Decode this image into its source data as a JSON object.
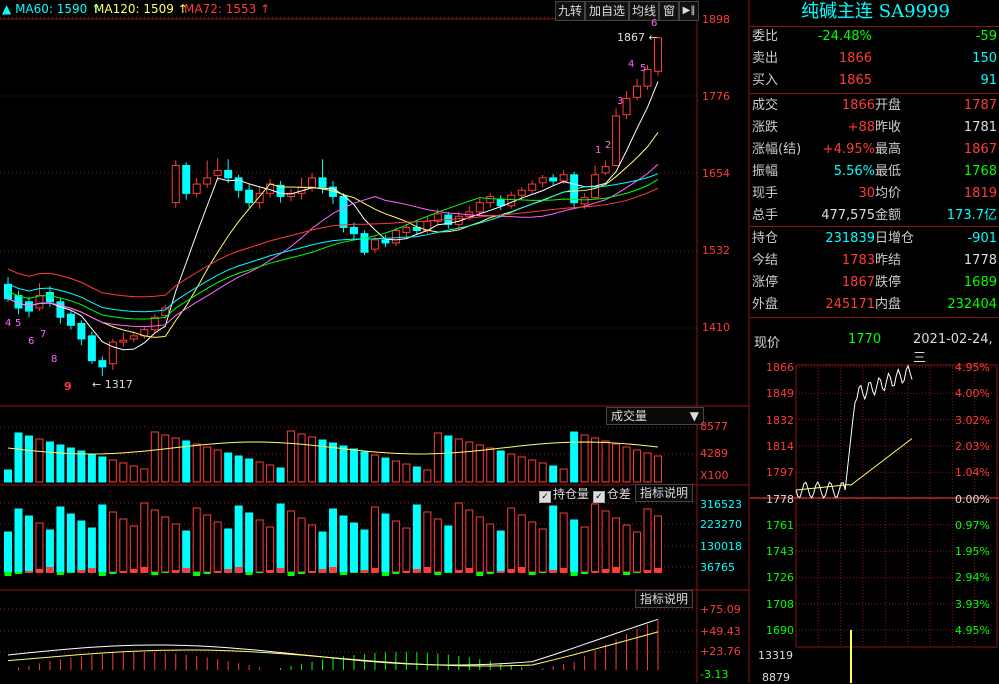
{
  "ma_legend": [
    {
      "label": "MA60: 1590",
      "color": "#00ffff"
    },
    {
      "label": "MA120: 1509",
      "color": "#ffff66"
    },
    {
      "label": "MA72: 1553",
      "color": "#ff3a3a"
    }
  ],
  "toolbar": {
    "jiuzhuan": "九转",
    "jiazixuan": "加自选",
    "junxian": "均线",
    "chuang": "窗",
    "side_icon": "▶‖"
  },
  "main_axis": [
    "1898",
    "1776",
    "1654",
    "1532",
    "1410"
  ],
  "annot": {
    "high": "1867",
    "low": "1317"
  },
  "nine_turn_up": [
    "1",
    "2",
    "3",
    "4",
    "5",
    "6"
  ],
  "nine_turn_down": [
    "4",
    "5",
    "6",
    "7",
    "8",
    "9"
  ],
  "volume": {
    "selector": "成交量",
    "axis": [
      "8577",
      "4289",
      "X100"
    ]
  },
  "oi": {
    "chk1": "持仓量",
    "chk2": "仓差",
    "btn": "指标说明",
    "axis": [
      "316523",
      "223270",
      "130018",
      "36765"
    ]
  },
  "ind": {
    "btn": "指标说明",
    "axis": [
      "+75.09",
      "+49.43",
      "+23.76",
      "-3.13"
    ]
  },
  "quote": {
    "title": "纯碱主连 SA9999",
    "rows": [
      {
        "l1": "委比",
        "v1": "-24.48%",
        "c1": "green",
        "v2": "-59",
        "c2": "green"
      },
      {
        "l1": "卖出",
        "v1": "1866",
        "c1": "red",
        "v2": "150",
        "c2": "cyan"
      },
      {
        "l1": "买入",
        "v1": "1865",
        "c1": "red",
        "v2": "91",
        "c2": "cyan"
      },
      {
        "l1": "成交",
        "v1": "1866",
        "c1": "red",
        "l2": "开盘",
        "v2": "1787",
        "c2": "red"
      },
      {
        "l1": "涨跌",
        "v1": "+88",
        "c1": "red",
        "l2": "昨收",
        "v2": "1781",
        "c2": "white"
      },
      {
        "l1": "涨幅(结)",
        "v1": "+4.95%",
        "c1": "red",
        "l2": "最高",
        "v2": "1867",
        "c2": "red"
      },
      {
        "l1": "振幅",
        "v1": "5.56%",
        "c1": "cyan",
        "l2": "最低",
        "v2": "1768",
        "c2": "green"
      },
      {
        "l1": "现手",
        "v1": "30",
        "c1": "red",
        "l2": "均价",
        "v2": "1819",
        "c2": "red"
      },
      {
        "l1": "总手",
        "v1": "477,575",
        "c1": "white",
        "l2": "金额",
        "v2": "173.7亿",
        "c2": "cyan"
      },
      {
        "l1": "持仓",
        "v1": "231839",
        "c1": "cyan",
        "l2": "日增仓",
        "v2": "-901",
        "c2": "cyan"
      },
      {
        "l1": "今结",
        "v1": "1783",
        "c1": "red",
        "l2": "昨结",
        "v2": "1778",
        "c2": "white"
      },
      {
        "l1": "涨停",
        "v1": "1867",
        "c1": "red",
        "l2": "跌停",
        "v2": "1689",
        "c2": "green"
      },
      {
        "l1": "外盘",
        "v1": "245171",
        "c1": "red",
        "l2": "内盘",
        "v2": "232404",
        "c2": "green"
      }
    ],
    "now_label": "现价",
    "now_value": "1770",
    "date": "2021-02-24,三"
  },
  "mini": {
    "left_axis": [
      {
        "v": "1866",
        "c": "#ff3a3a"
      },
      {
        "v": "1849",
        "c": "#ff3a3a"
      },
      {
        "v": "1832",
        "c": "#ff3a3a"
      },
      {
        "v": "1814",
        "c": "#ff3a3a"
      },
      {
        "v": "1797",
        "c": "#ff3a3a"
      },
      {
        "v": "1778",
        "c": "#ddd"
      },
      {
        "v": "1761",
        "c": "#00ff00"
      },
      {
        "v": "1743",
        "c": "#00ff00"
      },
      {
        "v": "1726",
        "c": "#00ff00"
      },
      {
        "v": "1708",
        "c": "#00ff00"
      },
      {
        "v": "1690",
        "c": "#00ff00"
      }
    ],
    "right_axis": [
      {
        "v": "4.95%",
        "c": "#ff3a3a"
      },
      {
        "v": "4.00%",
        "c": "#ff3a3a"
      },
      {
        "v": "3.02%",
        "c": "#ff3a3a"
      },
      {
        "v": "2.03%",
        "c": "#ff3a3a"
      },
      {
        "v": "1.04%",
        "c": "#ff3a3a"
      },
      {
        "v": "0.00%",
        "c": "#ddd"
      },
      {
        "v": "0.97%",
        "c": "#00ff00"
      },
      {
        "v": "1.95%",
        "c": "#00ff00"
      },
      {
        "v": "2.94%",
        "c": "#00ff00"
      },
      {
        "v": "3.93%",
        "c": "#00ff00"
      },
      {
        "v": "4.95%",
        "c": "#00ff00"
      }
    ],
    "vol_axis": [
      "13319",
      "8879"
    ]
  },
  "chart_data": {
    "type": "candlestick",
    "candles": [
      [
        1468,
        1445,
        1480,
        1440
      ],
      [
        1450,
        1430,
        1458,
        1420
      ],
      [
        1440,
        1425,
        1448,
        1415
      ],
      [
        1430,
        1450,
        1470,
        1425
      ],
      [
        1455,
        1440,
        1465,
        1432
      ],
      [
        1440,
        1415,
        1446,
        1405
      ],
      [
        1420,
        1402,
        1425,
        1395
      ],
      [
        1405,
        1380,
        1410,
        1370
      ],
      [
        1385,
        1345,
        1392,
        1340
      ],
      [
        1345,
        1335,
        1352,
        1320
      ],
      [
        1340,
        1375,
        1380,
        1330
      ],
      [
        1375,
        1378,
        1390,
        1368
      ],
      [
        1380,
        1385,
        1392,
        1375
      ],
      [
        1385,
        1395,
        1400,
        1380
      ],
      [
        1395,
        1415,
        1420,
        1390
      ],
      [
        1418,
        1430,
        1435,
        1412
      ],
      [
        1600,
        1660,
        1668,
        1592
      ],
      [
        1660,
        1615,
        1665,
        1605
      ],
      [
        1615,
        1630,
        1640,
        1608
      ],
      [
        1630,
        1640,
        1668,
        1624
      ],
      [
        1644,
        1652,
        1672,
        1635
      ],
      [
        1652,
        1640,
        1670,
        1632
      ],
      [
        1640,
        1620,
        1645,
        1608
      ],
      [
        1620,
        1600,
        1630,
        1592
      ],
      [
        1600,
        1615,
        1625,
        1590
      ],
      [
        1615,
        1630,
        1638,
        1608
      ],
      [
        1628,
        1610,
        1635,
        1600
      ],
      [
        1610,
        1615,
        1622,
        1602
      ],
      [
        1615,
        1625,
        1640,
        1605
      ],
      [
        1625,
        1640,
        1648,
        1618
      ],
      [
        1640,
        1625,
        1670,
        1615
      ],
      [
        1625,
        1610,
        1635,
        1598
      ],
      [
        1610,
        1560,
        1615,
        1552
      ],
      [
        1560,
        1550,
        1568,
        1540
      ],
      [
        1550,
        1520,
        1555,
        1515
      ],
      [
        1525,
        1540,
        1545,
        1518
      ],
      [
        1540,
        1535,
        1548,
        1528
      ],
      [
        1535,
        1555,
        1560,
        1530
      ],
      [
        1552,
        1560,
        1566,
        1545
      ],
      [
        1560,
        1555,
        1570,
        1548
      ],
      [
        1555,
        1570,
        1578,
        1550
      ],
      [
        1570,
        1582,
        1590,
        1565
      ],
      [
        1580,
        1565,
        1585,
        1558
      ],
      [
        1565,
        1578,
        1585,
        1558
      ],
      [
        1578,
        1585,
        1595,
        1572
      ],
      [
        1585,
        1600,
        1608,
        1578
      ],
      [
        1600,
        1610,
        1615,
        1592
      ],
      [
        1605,
        1595,
        1612,
        1588
      ],
      [
        1595,
        1612,
        1618,
        1590
      ],
      [
        1612,
        1620,
        1625,
        1605
      ],
      [
        1620,
        1630,
        1636,
        1615
      ],
      [
        1632,
        1640,
        1645,
        1625
      ],
      [
        1640,
        1635,
        1646,
        1628
      ],
      [
        1635,
        1645,
        1652,
        1630
      ],
      [
        1645,
        1600,
        1650,
        1592
      ],
      [
        1598,
        1608,
        1615,
        1590
      ],
      [
        1608,
        1645,
        1660,
        1605
      ],
      [
        1648,
        1658,
        1668,
        1645
      ],
      [
        1660,
        1740,
        1752,
        1658
      ],
      [
        1742,
        1768,
        1780,
        1735
      ],
      [
        1770,
        1788,
        1800,
        1765
      ],
      [
        1788,
        1815,
        1822,
        1782
      ],
      [
        1812,
        1866,
        1867,
        1805
      ]
    ],
    "ylim": [
      1317,
      1898
    ]
  }
}
